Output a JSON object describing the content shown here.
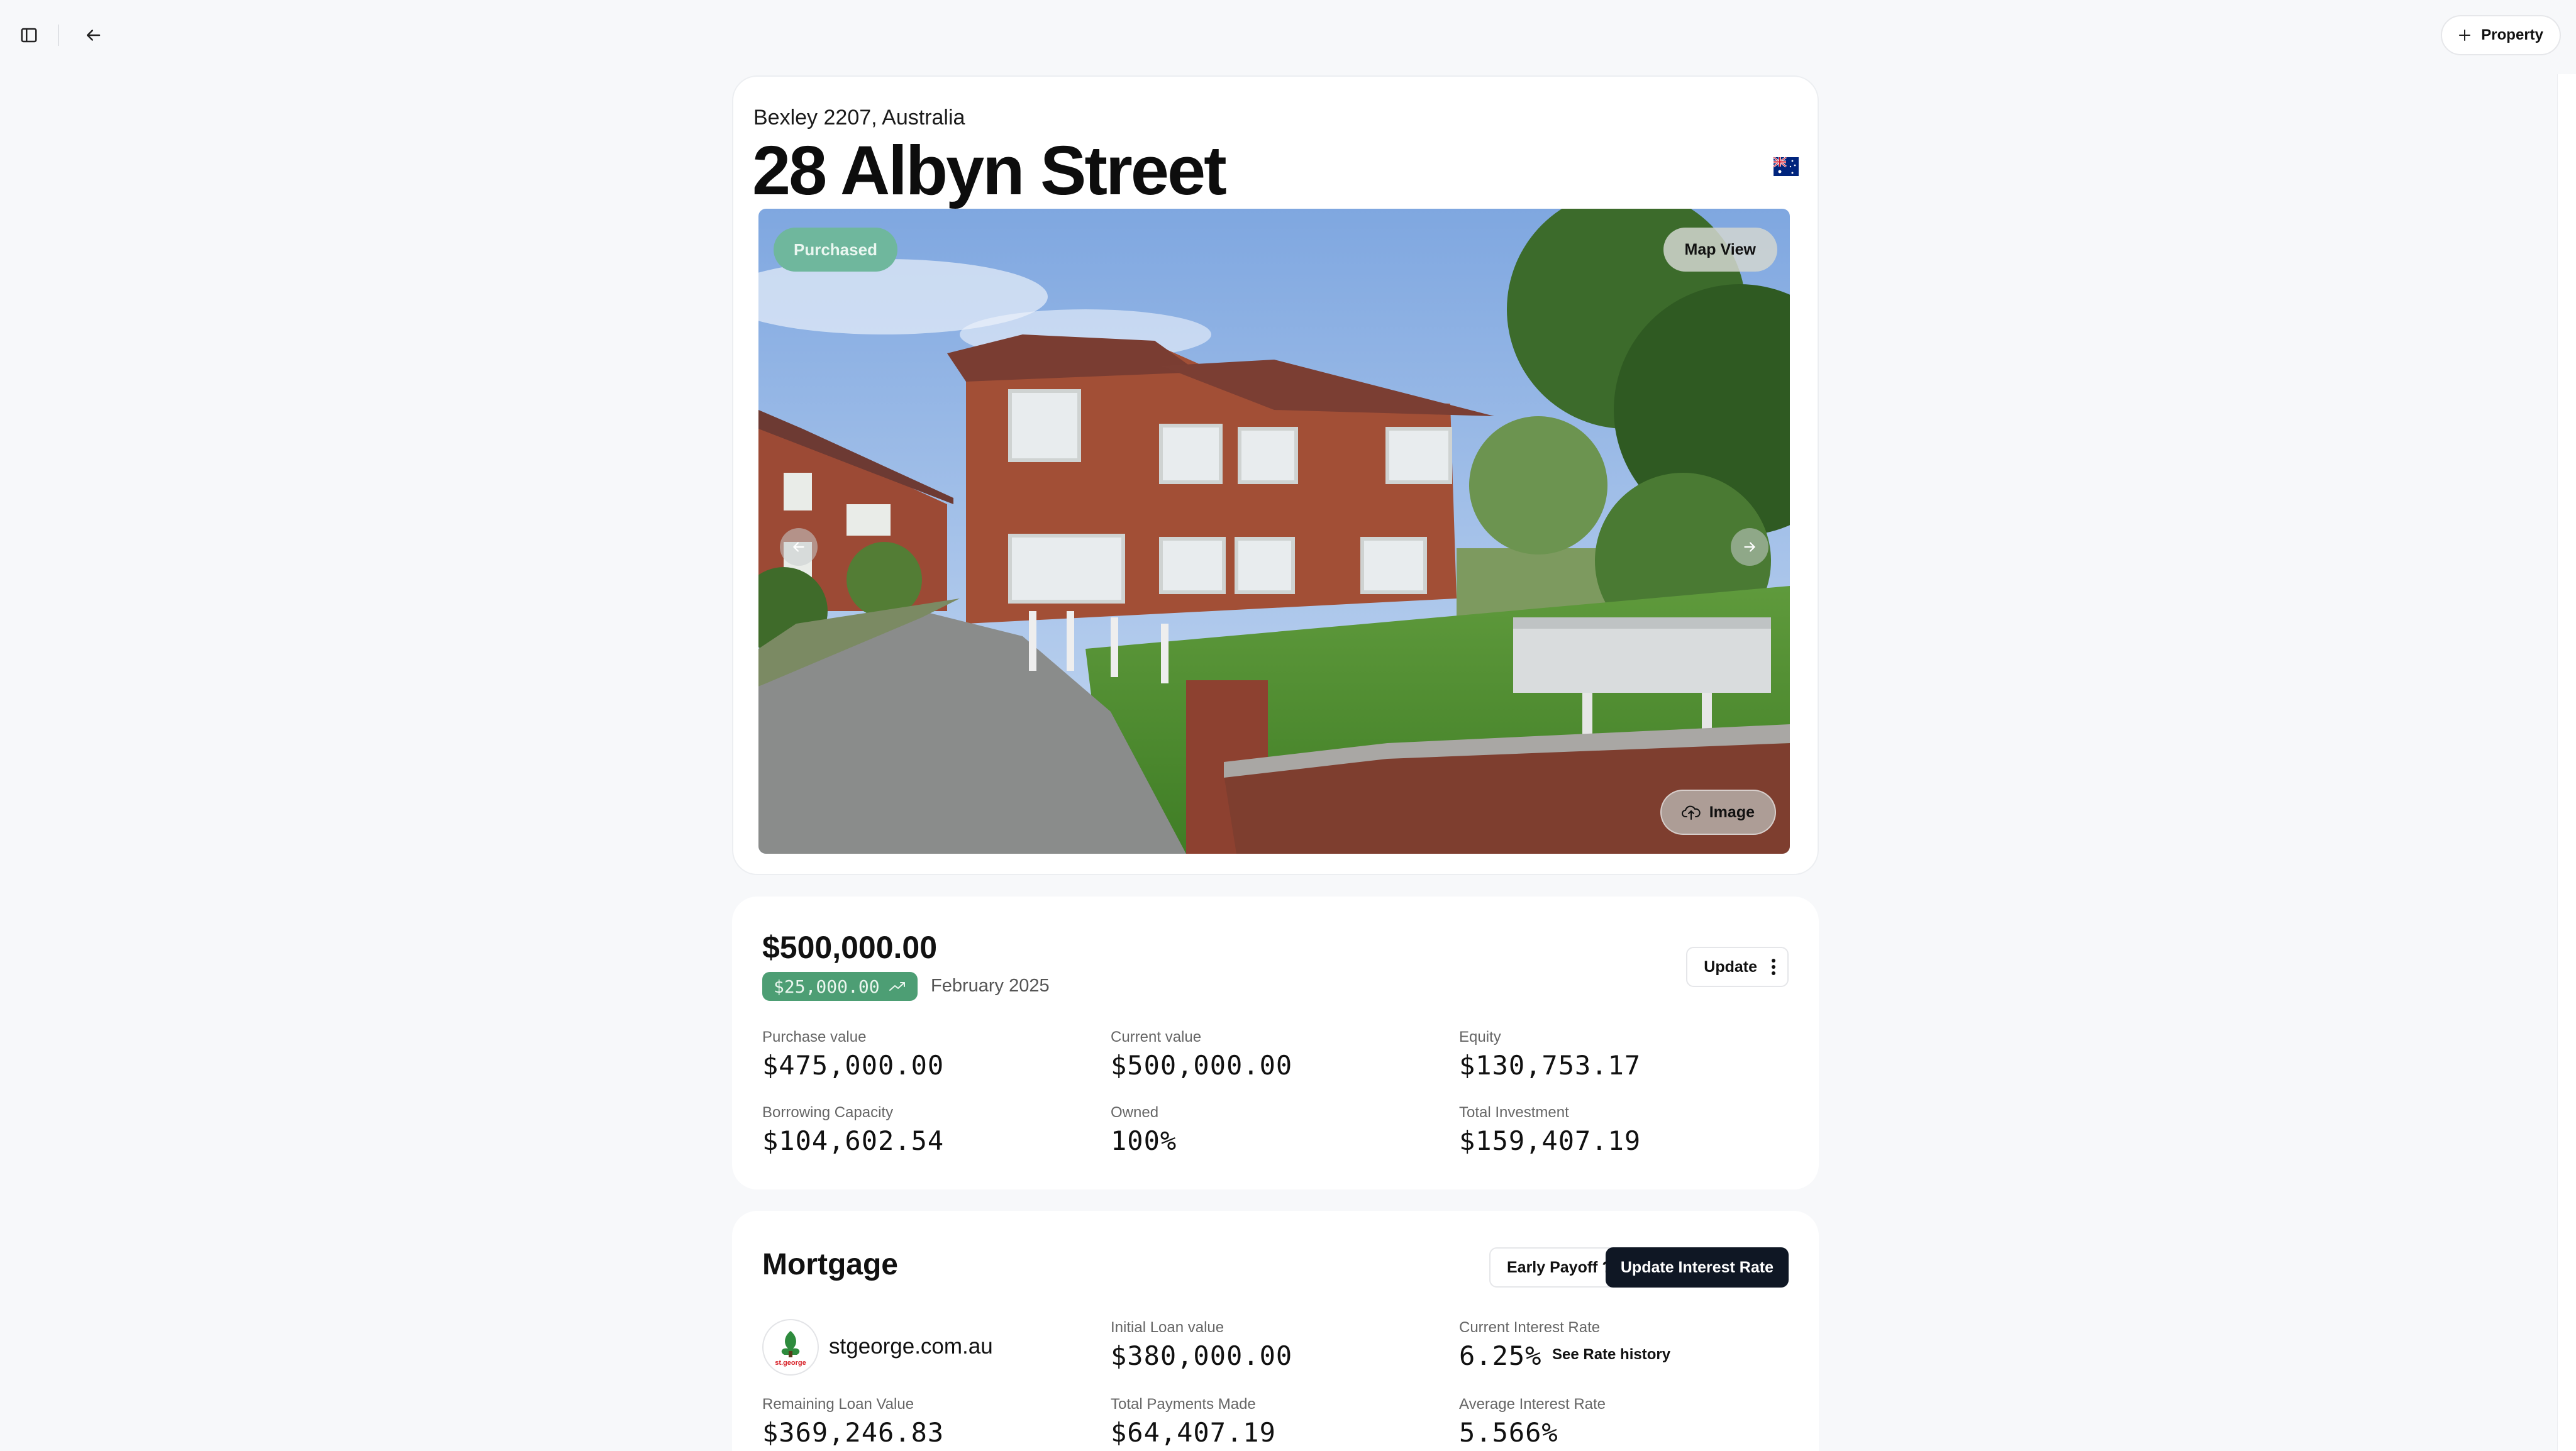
{
  "topbar": {
    "add_property_label": "Property",
    "icons": [
      "sidebar-toggle-icon",
      "arrow-left-icon",
      "plus-icon"
    ]
  },
  "property": {
    "suburb": "Bexley 2207, Australia",
    "street": "28 Albyn Street",
    "status_badge": "Purchased",
    "map_view_label": "Map View",
    "image_button_label": "Image"
  },
  "valuation": {
    "current_value": "$500,000.00",
    "gain": "$25,000.00",
    "gain_date": "February 2025",
    "update_label": "Update",
    "stats": [
      {
        "label": "Purchase value",
        "value": "$475,000.00"
      },
      {
        "label": "Current value",
        "value": "$500,000.00"
      },
      {
        "label": "Equity",
        "value": "$130,753.17"
      },
      {
        "label": "Borrowing Capacity",
        "value": "$104,602.54"
      },
      {
        "label": "Owned",
        "value": "100%"
      },
      {
        "label": "Total Investment",
        "value": "$159,407.19"
      }
    ]
  },
  "mortgage": {
    "title": "Mortgage",
    "early_payoff_label": "Early Payoff ?",
    "update_rate_label": "Update Interest Rate",
    "lender": "stgeorge.com.au",
    "lender_logo_text": "st.george",
    "see_rate_history_label": "See Rate history",
    "stats": [
      {
        "label": "Initial Loan value",
        "value": "$380,000.00"
      },
      {
        "label": "Current Interest Rate",
        "value": "6.25%"
      },
      {
        "label": "Remaining Loan Value",
        "value": "$369,246.83"
      },
      {
        "label": "Total Payments Made",
        "value": "$64,407.19"
      },
      {
        "label": "Average Interest Rate",
        "value": "5.566%"
      }
    ]
  },
  "colors": {
    "accent_dark": "#0f1724",
    "purchased_badge": "#6fb79d",
    "gain_badge": "#4d9e74",
    "background": "#f7f8fa"
  }
}
